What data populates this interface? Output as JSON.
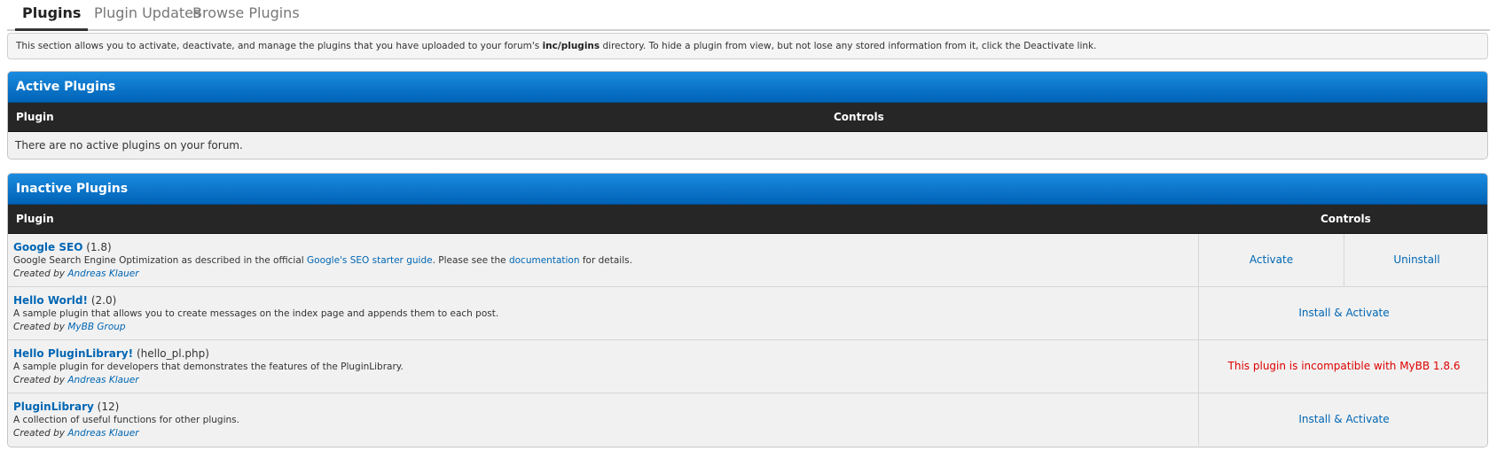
{
  "tabs": [
    {
      "label": "Plugins"
    },
    {
      "label": "Plugin Updates"
    },
    {
      "label": "Browse Plugins"
    }
  ],
  "description": {
    "before": "This section allows you to activate, deactivate, and manage the plugins that you have uploaded to your forum's ",
    "path": "inc/plugins",
    "after": " directory. To hide a plugin from view, but not lose any stored information from it, click the Deactivate link."
  },
  "active_panel": {
    "title": "Active Plugins",
    "col_plugin": "Plugin",
    "col_controls": "Controls",
    "empty_message": "There are no active plugins on your forum."
  },
  "inactive_panel": {
    "title": "Inactive Plugins",
    "col_plugin": "Plugin",
    "col_controls": "Controls",
    "plugins": [
      {
        "name": "Google SEO",
        "version": "(1.8)",
        "desc_before": "Google Search Engine Optimization as described in the official ",
        "desc_link1": "Google's SEO starter guide",
        "desc_middle": ". Please see the ",
        "desc_link2": "documentation",
        "desc_after": " for details.",
        "created_by": "Created by ",
        "author": "Andreas Klauer",
        "activate": "Activate",
        "uninstall": "Uninstall"
      },
      {
        "name": "Hello World!",
        "version": "(2.0)",
        "desc": "A sample plugin that allows you to create messages on the index page and appends them to each post.",
        "created_by": "Created by ",
        "author": "MyBB Group",
        "install_activate": "Install & Activate"
      },
      {
        "name": "Hello PluginLibrary!",
        "version": "(hello_pl.php)",
        "desc": "A sample plugin for developers that demonstrates the features of the PluginLibrary.",
        "created_by": "Created by ",
        "author": "Andreas Klauer",
        "incompatible": "This plugin is incompatible with MyBB 1.8.6"
      },
      {
        "name": "PluginLibrary",
        "version": "(12)",
        "desc": "A collection of useful functions for other plugins.",
        "created_by": "Created by ",
        "author": "Andreas Klauer",
        "install_activate": "Install & Activate"
      }
    ]
  },
  "colors": {
    "header_blue": "#0070c9",
    "column_header": "#262626",
    "link": "#0066b3",
    "error": "#e00000"
  }
}
